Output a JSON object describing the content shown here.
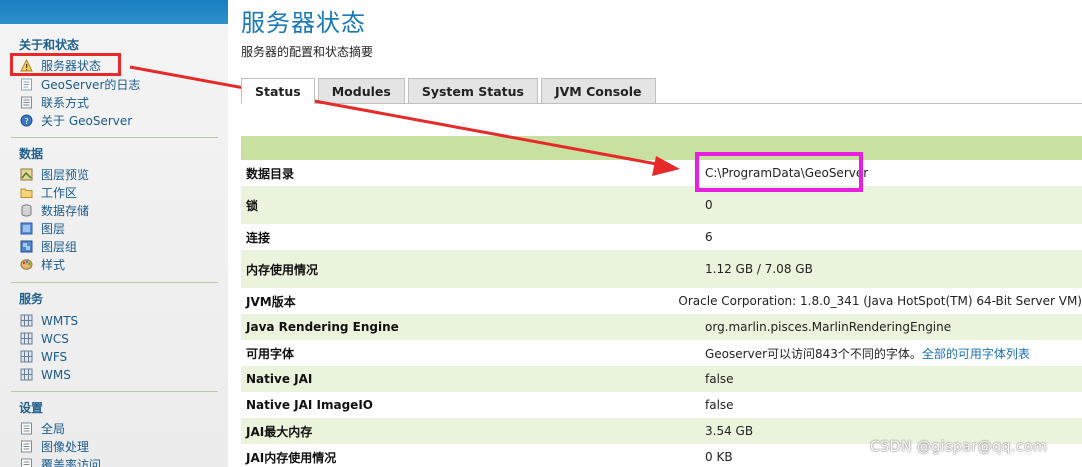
{
  "sidebar": {
    "about": {
      "title": "关于和状态",
      "items": [
        {
          "label": "服务器状态",
          "icon": "server-status-icon"
        },
        {
          "label": "GeoServer的日志",
          "icon": "log-icon"
        },
        {
          "label": "联系方式",
          "icon": "contact-icon"
        },
        {
          "label": "关于 GeoServer",
          "icon": "help-icon"
        }
      ]
    },
    "data": {
      "title": "数据",
      "items": [
        {
          "label": "图层预览",
          "icon": "layer-preview-icon"
        },
        {
          "label": "工作区",
          "icon": "folder-icon"
        },
        {
          "label": "数据存储",
          "icon": "database-icon"
        },
        {
          "label": "图层",
          "icon": "layer-icon"
        },
        {
          "label": "图层组",
          "icon": "layer-group-icon"
        },
        {
          "label": "样式",
          "icon": "palette-icon"
        }
      ]
    },
    "services": {
      "title": "服务",
      "items": [
        {
          "label": "WMTS",
          "icon": "wmts-icon"
        },
        {
          "label": "WCS",
          "icon": "wcs-icon"
        },
        {
          "label": "WFS",
          "icon": "wfs-icon"
        },
        {
          "label": "WMS",
          "icon": "wms-icon"
        }
      ]
    },
    "settings": {
      "title": "设置",
      "items": [
        {
          "label": "全局",
          "icon": "global-icon"
        },
        {
          "label": "图像处理",
          "icon": "image-processing-icon"
        },
        {
          "label": "覆盖率访问",
          "icon": "coverage-access-icon"
        }
      ]
    }
  },
  "header": {
    "title": "服务器状态",
    "subtitle": "服务器的配置和状态摘要"
  },
  "tabs": [
    "Status",
    "Modules",
    "System Status",
    "JVM Console"
  ],
  "status_rows": [
    {
      "key": "数据目录",
      "value": "C:\\ProgramData\\GeoServer"
    },
    {
      "key": "锁",
      "value": "0"
    },
    {
      "key": "连接",
      "value": "6"
    },
    {
      "key": "内存使用情况",
      "value": "1.12 GB / 7.08 GB"
    },
    {
      "key": "JVM版本",
      "value": "Oracle Corporation: 1.8.0_341 (Java HotSpot(TM) 64-Bit Server VM)"
    },
    {
      "key": "Java Rendering Engine",
      "value": "org.marlin.pisces.MarlinRenderingEngine"
    },
    {
      "key": "可用字体",
      "value": "Geoserver可以访问843个不同的字体。",
      "link": "全部的可用字体列表"
    },
    {
      "key": "Native JAI",
      "value": "false"
    },
    {
      "key": "Native JAI ImageIO",
      "value": "false"
    },
    {
      "key": "JAI最大内存",
      "value": "3.54 GB"
    },
    {
      "key": "JAI内存使用情况",
      "value": "0 KB"
    }
  ],
  "watermark": "CSDN @gispar@qq.com",
  "colors": {
    "annotation_red": "#e62a2a",
    "annotation_magenta": "#e81ee0",
    "title_blue": "#1b79b8",
    "row_green": "#eaf3dc",
    "header_green": "#c8e0a0"
  }
}
